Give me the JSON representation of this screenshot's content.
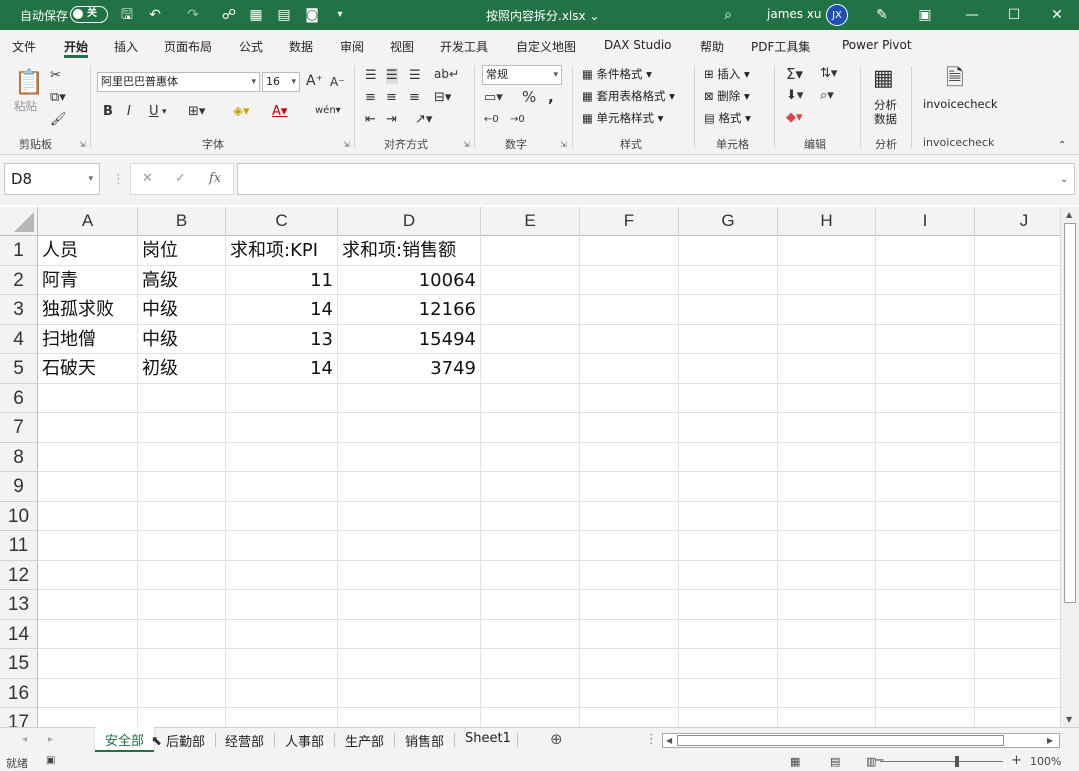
{
  "titlebar": {
    "autosave_label": "自动保存",
    "autosave_state": "关",
    "doc_title": "按照内容拆分.xlsx",
    "doc_title_caret": "⌄",
    "user_name": "james xu",
    "user_initials": "JX",
    "accent_color": "#217346"
  },
  "ribbon_tabs": [
    "文件",
    "开始",
    "插入",
    "页面布局",
    "公式",
    "数据",
    "审阅",
    "视图",
    "开发工具",
    "自定义地图",
    "DAX Studio",
    "帮助",
    "PDF工具集",
    "Power Pivot"
  ],
  "ribbon_actions": {
    "comments": "批注",
    "share": "共享"
  },
  "ribbon": {
    "clipboard": {
      "paste": "粘贴",
      "label": "剪贴板"
    },
    "font": {
      "font_name": "阿里巴巴普惠体",
      "font_size": "16",
      "label": "字体",
      "bold": "B",
      "italic": "I",
      "underline": "U",
      "grow": "A",
      "shrink": "A"
    },
    "alignment": {
      "label": "对齐方式"
    },
    "number": {
      "format": "常规",
      "label": "数字"
    },
    "styles": {
      "conditional": "条件格式",
      "table_format": "套用表格格式",
      "cell_styles": "单元格样式",
      "label": "样式"
    },
    "cells": {
      "insert": "插入",
      "delete": "删除",
      "format": "格式",
      "label": "单元格"
    },
    "editing": {
      "label": "编辑"
    },
    "analysis": {
      "analyze_line1": "分析",
      "analyze_line2": "数据",
      "label": "分析"
    },
    "invoice": {
      "button": "invoicecheck",
      "label": "invoicecheck"
    }
  },
  "formula_bar": {
    "name_box": "D8",
    "fx": "fx",
    "value": ""
  },
  "columns": [
    "A",
    "B",
    "C",
    "D",
    "E",
    "F",
    "G",
    "H",
    "I",
    "J"
  ],
  "rows": [
    "1",
    "2",
    "3",
    "4",
    "5",
    "6",
    "7",
    "8",
    "9",
    "10",
    "11",
    "12",
    "13",
    "14",
    "15",
    "16",
    "17"
  ],
  "table": {
    "headers": [
      "人员",
      "岗位",
      "求和项:KPI",
      "求和项:销售额"
    ],
    "rows": [
      [
        "阿青",
        "高级",
        "11",
        "10064"
      ],
      [
        "独孤求败",
        "中级",
        "14",
        "12166"
      ],
      [
        "扫地僧",
        "中级",
        "13",
        "15494"
      ],
      [
        "石破天",
        "初级",
        "14",
        "3749"
      ]
    ]
  },
  "sheets": [
    "安全部",
    "后勤部",
    "经营部",
    "人事部",
    "生产部",
    "销售部",
    "Sheet1"
  ],
  "active_sheet": "安全部",
  "status": {
    "ready": "就绪",
    "zoom": "100%"
  }
}
